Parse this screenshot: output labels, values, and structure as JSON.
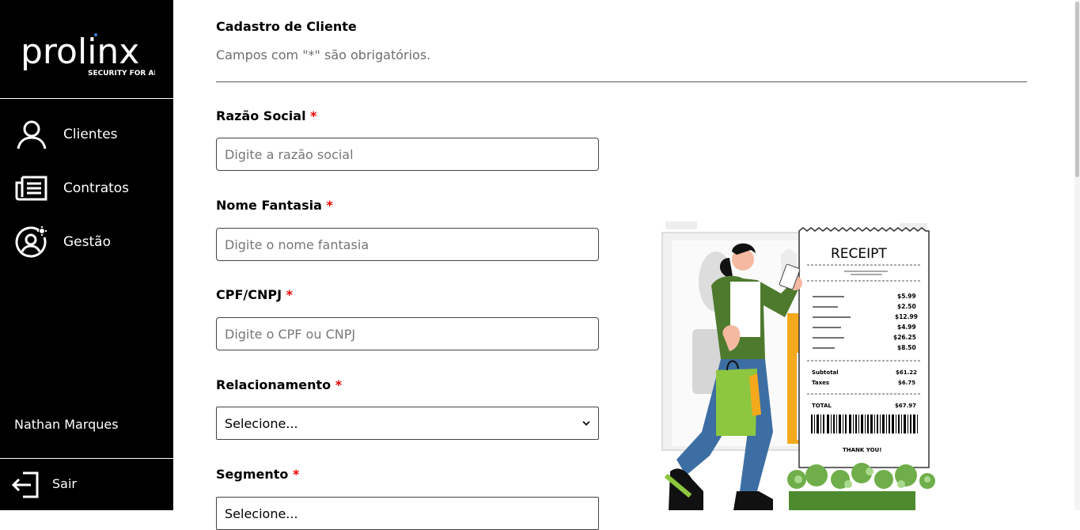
{
  "brand": {
    "name": "prolinx",
    "tagline": "SECURITY FOR ALL"
  },
  "nav": {
    "items": [
      {
        "label": "Clientes",
        "icon": "user-icon"
      },
      {
        "label": "Contratos",
        "icon": "document-list-icon"
      },
      {
        "label": "Gestão",
        "icon": "user-gear-icon"
      }
    ]
  },
  "user": {
    "name": "Nathan Marques"
  },
  "logout": {
    "label": "Sair",
    "icon": "logout-icon"
  },
  "form": {
    "title": "Cadastro de Cliente",
    "subtitle": "Campos com \"*\" são obrigatórios.",
    "required_mark": "*",
    "fields": {
      "razao": {
        "label": "Razão Social",
        "placeholder": "Digite a razão social"
      },
      "fantasia": {
        "label": "Nome Fantasia",
        "placeholder": "Digite o nome fantasia"
      },
      "cpf": {
        "label": "CPF/CNPJ",
        "placeholder": "Digite o CPF ou CNPJ"
      },
      "relacionamento": {
        "label": "Relacionamento",
        "value": "Selecione..."
      },
      "segmento": {
        "label": "Segmento",
        "value": "Selecione..."
      }
    }
  },
  "receipt": {
    "title": "RECEIPT",
    "items": [
      "$5.99",
      "$2.50",
      "$12.99",
      "$4.99",
      "$26.25",
      "$8.50"
    ],
    "subtotal_label": "Subtotal",
    "subtotal": "$61.22",
    "taxes_label": "Taxes",
    "taxes": "$6.75",
    "total_label": "TOTAL",
    "total": "$67.97",
    "thanks": "THANK YOU!"
  },
  "colors": {
    "sidebar": "#000000",
    "required": "#ee0000",
    "accent_green": "#8dc63f",
    "jacket": "#4e7a2e"
  }
}
